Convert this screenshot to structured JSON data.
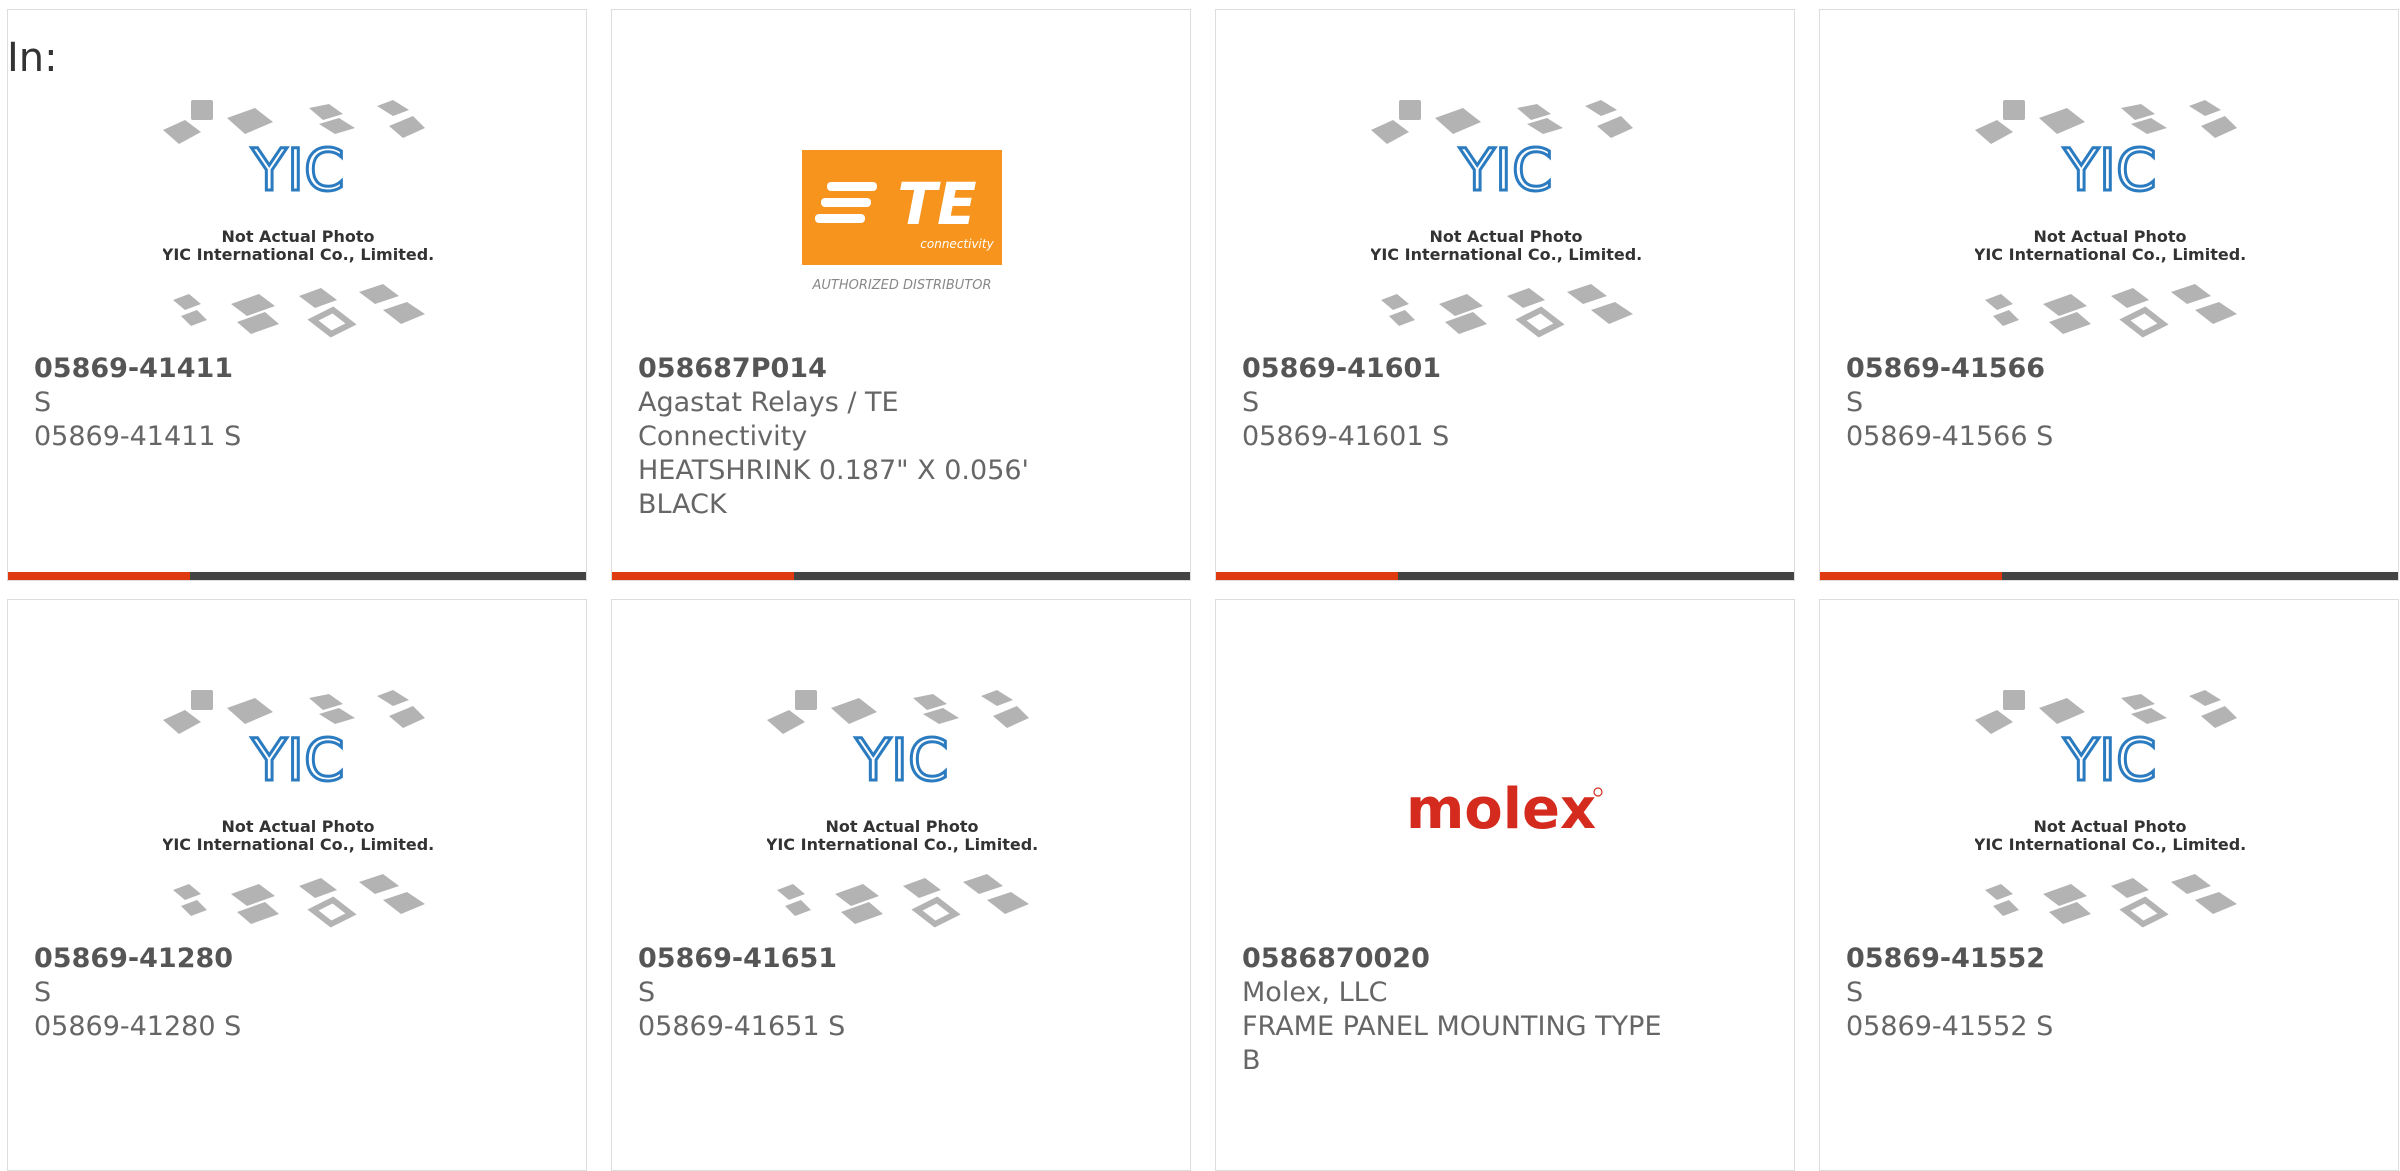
{
  "header": {
    "in_label": "In:"
  },
  "placeholder_image": {
    "line1": "Not Actual Photo",
    "line2": "YIC International Co., Limited.",
    "logo": "YIC"
  },
  "te_logo": {
    "mark": "TE",
    "sub": "connectivity",
    "caption": "AUTHORIZED DISTRIBUTOR",
    "color": "#f7941d"
  },
  "molex_logo": {
    "text": "molex",
    "color": "#d52b1e"
  },
  "accent_color": "#e03a10",
  "cards": [
    {
      "part_number": "05869-41411",
      "manufacturer": "S",
      "description": "05869-41411 S",
      "image": "yic-placeholder"
    },
    {
      "part_number": "058687P014",
      "manufacturer": "Agastat Relays / TE Connectivity",
      "description": "HEATSHRINK 0.187\" X 0.056' BLACK",
      "image": "te-logo"
    },
    {
      "part_number": "05869-41601",
      "manufacturer": "S",
      "description": "05869-41601 S",
      "image": "yic-placeholder"
    },
    {
      "part_number": "05869-41566",
      "manufacturer": "S",
      "description": "05869-41566 S",
      "image": "yic-placeholder"
    },
    {
      "part_number": "05869-41280",
      "manufacturer": "S",
      "description": "05869-41280 S",
      "image": "yic-placeholder"
    },
    {
      "part_number": "05869-41651",
      "manufacturer": "S",
      "description": "05869-41651 S",
      "image": "yic-placeholder"
    },
    {
      "part_number": "0586870020",
      "manufacturer": "Molex, LLC",
      "description": "FRAME PANEL MOUNTING TYPE B",
      "image": "molex-logo"
    },
    {
      "part_number": "05869-41552",
      "manufacturer": "S",
      "description": "05869-41552 S",
      "image": "yic-placeholder"
    }
  ]
}
